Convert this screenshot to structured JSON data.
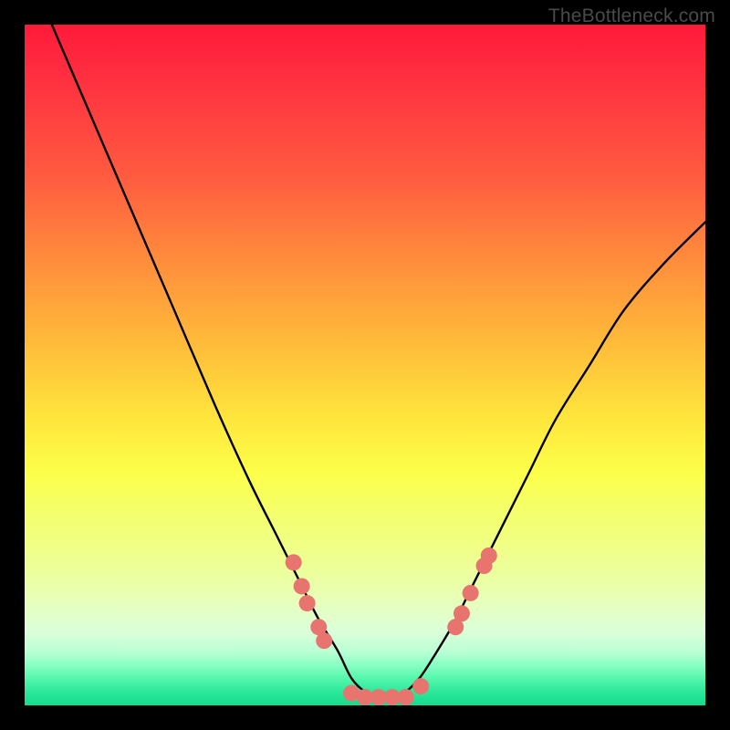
{
  "watermark": "TheBottleneck.com",
  "chart_data": {
    "type": "line",
    "title": "",
    "xlabel": "",
    "ylabel": "",
    "xlim": [
      0,
      100
    ],
    "ylim": [
      0,
      100
    ],
    "series": [
      {
        "name": "bottleneck-curve",
        "x": [
          4,
          10,
          16,
          22,
          28,
          33,
          37,
          40,
          43,
          46,
          48,
          50,
          52,
          54,
          56,
          58,
          60,
          63,
          66,
          70,
          74,
          78,
          83,
          88,
          94,
          100
        ],
        "y": [
          100,
          86,
          72,
          58,
          44,
          33,
          25,
          19,
          13,
          8,
          4,
          2,
          1,
          1,
          2,
          4,
          7,
          12,
          18,
          26,
          34,
          42,
          50,
          58,
          65,
          71
        ]
      }
    ],
    "markers": [
      {
        "x": 39.5,
        "y": 21,
        "r": 9
      },
      {
        "x": 40.7,
        "y": 17.5,
        "r": 9
      },
      {
        "x": 41.5,
        "y": 15,
        "r": 9
      },
      {
        "x": 43.2,
        "y": 11.5,
        "r": 9
      },
      {
        "x": 44.0,
        "y": 9.5,
        "r": 9
      },
      {
        "x": 48.0,
        "y": 1.8,
        "r": 9
      },
      {
        "x": 50.0,
        "y": 1.2,
        "r": 9
      },
      {
        "x": 52.0,
        "y": 1.2,
        "r": 9
      },
      {
        "x": 54.0,
        "y": 1.2,
        "r": 9
      },
      {
        "x": 56.0,
        "y": 1.2,
        "r": 9
      },
      {
        "x": 58.2,
        "y": 2.8,
        "r": 9
      },
      {
        "x": 63.3,
        "y": 11.5,
        "r": 9
      },
      {
        "x": 64.2,
        "y": 13.5,
        "r": 9
      },
      {
        "x": 65.5,
        "y": 16.5,
        "r": 9
      },
      {
        "x": 67.5,
        "y": 20.5,
        "r": 9
      },
      {
        "x": 68.2,
        "y": 22.0,
        "r": 9
      }
    ],
    "marker_color": "#e8746f",
    "curve_color": "#000000"
  }
}
